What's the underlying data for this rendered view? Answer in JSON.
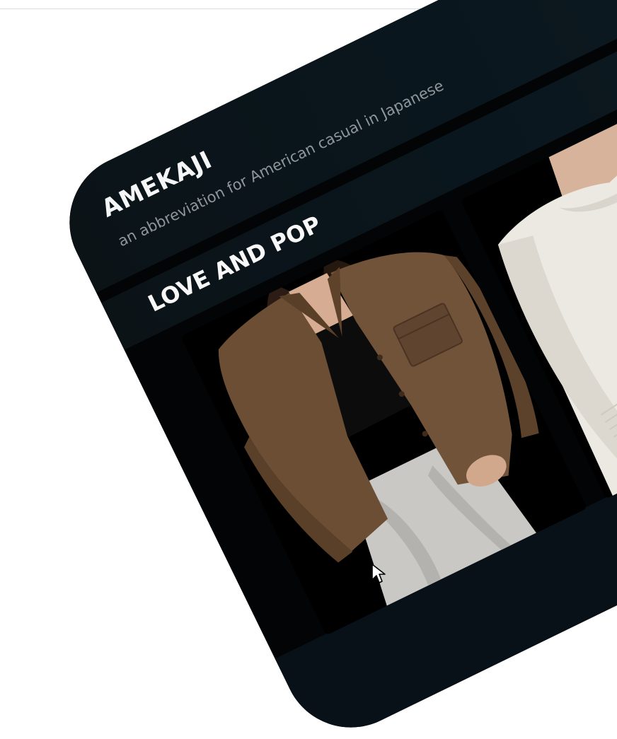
{
  "card": {
    "title": "AMEKAJI",
    "subtitle": "an abbreviation for American casual in Japanese",
    "section_title": "LOVE AND POP"
  },
  "products": [
    {
      "name": "brown-corduroy-jacket-photo",
      "colors": {
        "jacket": "#6b4e33",
        "pants": "#c9c8c4",
        "top": "#0c0c0c",
        "hair": "#2b1d15"
      }
    },
    {
      "name": "cream-knit-sweater-photo",
      "colors": {
        "sweater": "#ece9e2",
        "skin": "#d8b39c",
        "bag": "#b8aa98"
      }
    }
  ],
  "theme": {
    "card_background": "#030405",
    "band": "#0b1317",
    "title_color": "#f4f6f7",
    "subtitle_color": "#8e969a"
  },
  "icons": [
    "mouse-pointer-icon"
  ]
}
